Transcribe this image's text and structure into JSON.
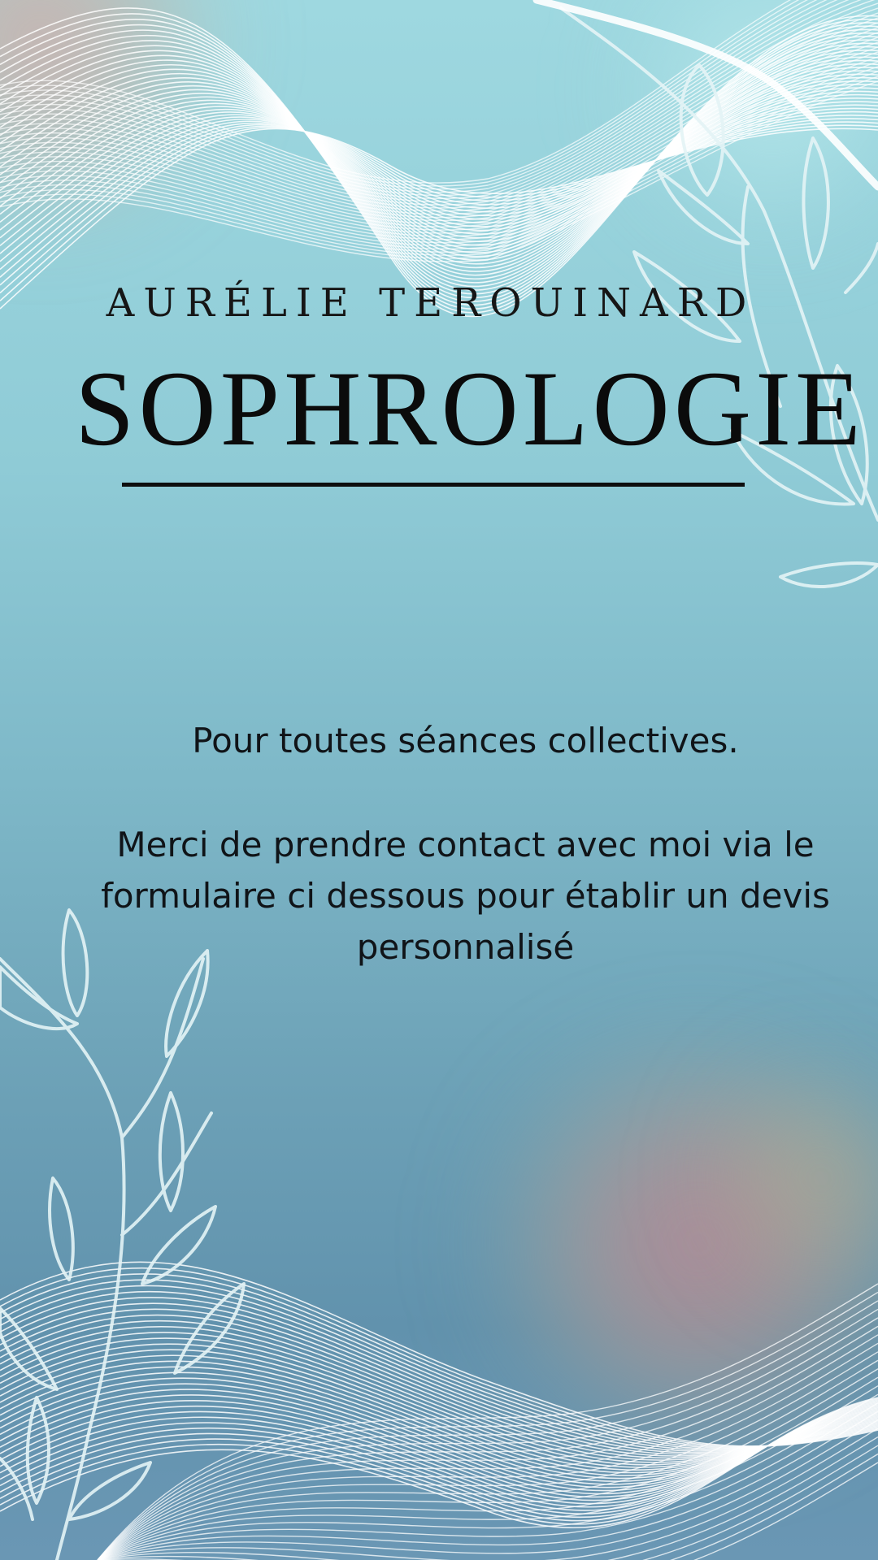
{
  "header": {
    "author": "AURÉLIE TEROUINARD",
    "title": "SOPHROLOGIE"
  },
  "message": {
    "intro": "Pour toutes séances collectives.",
    "body": "Merci de prendre contact avec moi via le formulaire ci dessous pour établir un devis personnalisé"
  },
  "decorations": {
    "top_left": "wave-lines",
    "top_right": "leaf-branch",
    "bottom_left": "leaf-branch",
    "bottom": "wave-lines"
  },
  "colors": {
    "background_top": "#9ed8e0",
    "background_bottom": "#6192ad",
    "line_art": "#ffffff",
    "text": "#101418"
  }
}
